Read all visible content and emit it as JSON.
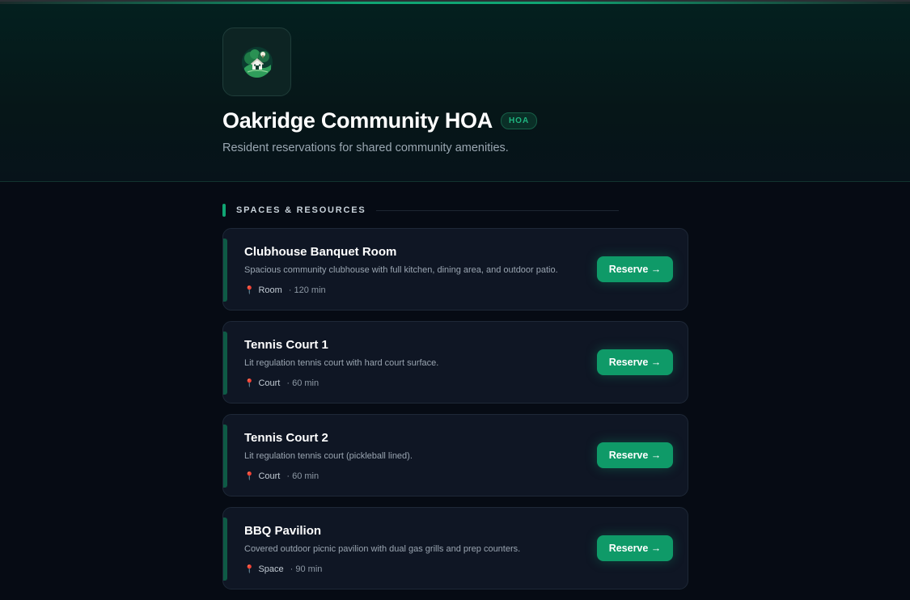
{
  "org": {
    "title": "Oakridge Community HOA",
    "badge": "HOA",
    "subtitle": "Resident reservations for shared community amenities.",
    "logo_icon": "house-tree-logo-icon"
  },
  "section": {
    "label": "SPACES & RESOURCES"
  },
  "resources": [
    {
      "name": "Clubhouse Banquet Room",
      "description": "Spacious community clubhouse with full kitchen, dining area, and outdoor patio.",
      "type": "Room",
      "duration": "· 120 min",
      "action": "Reserve →"
    },
    {
      "name": "Tennis Court 1",
      "description": "Lit regulation tennis court with hard court surface.",
      "type": "Court",
      "duration": "· 60 min",
      "action": "Reserve →"
    },
    {
      "name": "Tennis Court 2",
      "description": "Lit regulation tennis court (pickleball lined).",
      "type": "Court",
      "duration": "· 60 min",
      "action": "Reserve →"
    },
    {
      "name": "BBQ Pavilion",
      "description": "Covered outdoor picnic pavilion with dual gas grills and prep counters.",
      "type": "Space",
      "duration": "· 90 min",
      "action": "Reserve →"
    }
  ],
  "colors": {
    "accent": "#10a573",
    "background": "#060b14",
    "card": "#0f1624"
  }
}
